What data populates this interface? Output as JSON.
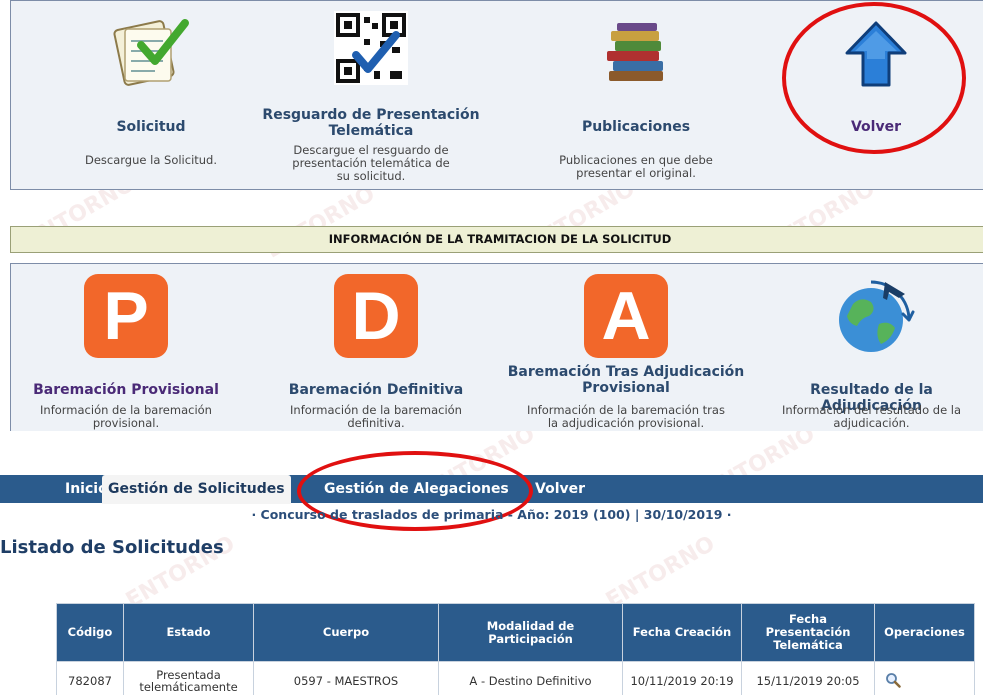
{
  "documents": [
    {
      "title": "Solicitud",
      "desc": "Descargue la Solicitud.",
      "icon": "form-checklist-icon"
    },
    {
      "title": "Resguardo de Presentación Telemática",
      "desc": "Descargue el resguardo de presentación telemática de su solicitud.",
      "icon": "qr-code-icon"
    },
    {
      "title": "Publicaciones",
      "desc": "Publicaciones en que debe presentar el original.",
      "icon": "books-icon"
    },
    {
      "title": "Volver",
      "desc": "",
      "icon": "up-arrow-icon"
    }
  ],
  "info_bar": "INFORMACIÓN DE LA TRAMITACION DE LA SOLICITUD",
  "tramitacion": [
    {
      "title": "Baremación Provisional",
      "desc": "Información de la baremación provisional.",
      "letter": "P"
    },
    {
      "title": "Baremación Definitiva",
      "desc": "Información de la baremación definitiva.",
      "letter": "D"
    },
    {
      "title": "Baremación Tras Adjudicación Provisional",
      "desc": "Información de la baremación tras la adjudicación provisional.",
      "letter": "A"
    },
    {
      "title": "Resultado de la Adjudicación",
      "desc": "Información del resultado de la adjudicación.",
      "icon": "globe-plane-icon"
    }
  ],
  "nav": {
    "inicio": "Inicio",
    "gestion_solicitudes": "Gestión de Solicitudes",
    "gestion_alegaciones": "Gestión de Alegaciones",
    "volver": "Volver"
  },
  "sub_info": "· Concurso de traslados de primaria - Año: 2019 (100) | 30/10/2019 ·",
  "page_title": "Listado de Solicitudes",
  "table": {
    "headers": [
      "Código",
      "Estado",
      "Cuerpo",
      "Modalidad de Participación",
      "Fecha Creación",
      "Fecha Presentación Telemática",
      "Operaciones"
    ],
    "rows": [
      [
        "782087",
        "Presentada telemáticamente",
        "0597 - MAESTROS",
        "A - Destino Definitivo",
        "10/11/2019 20:19",
        "15/11/2019 20:05",
        ""
      ]
    ]
  },
  "watermark": "ENTORNO DE PRUEBAS",
  "colors": {
    "nav": "#2b5b8c",
    "accent_orange": "#f2672a",
    "annotation_red": "#e01010"
  }
}
